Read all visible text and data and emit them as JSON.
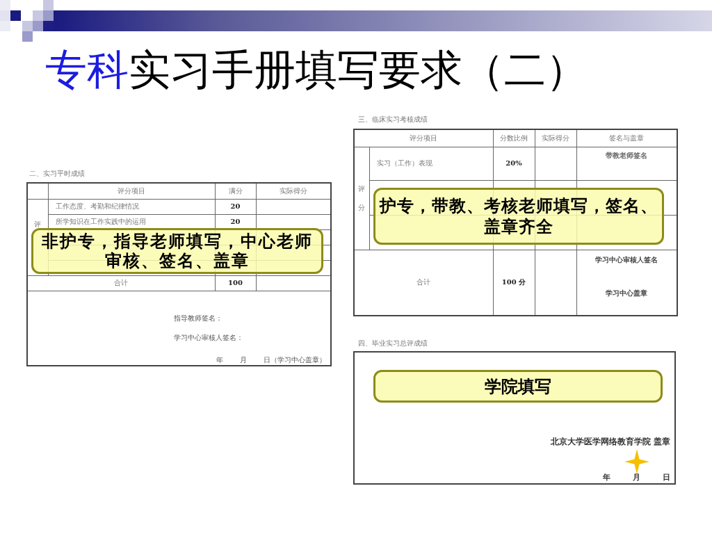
{
  "header": {
    "title_parts": [
      {
        "kind": "highlight",
        "text": "专科"
      },
      {
        "kind": "plain",
        "text": "实习手册填写要求（二）"
      }
    ]
  },
  "left_form": {
    "heading": "二、实习平时成绩",
    "columns": [
      "评分项目",
      "满分",
      "实际得分"
    ],
    "side_label": "评",
    "rows": [
      {
        "item": "工作态度、考勤和纪律情况",
        "full_score": "20"
      },
      {
        "item": "所学知识在工作实践中的运用",
        "full_score": "20"
      }
    ],
    "total": {
      "label": "合计",
      "full_score": "100"
    },
    "signatures": [
      "指导教师签名：",
      "学习中心审核人签名："
    ],
    "date_parts": [
      "年",
      "月",
      "日（学习中心盖章）"
    ],
    "callout": [
      "非护专，指导老师填写，中心老师",
      "审核、签名、盖章"
    ]
  },
  "clinical_form": {
    "heading": "三、临床实习考核成绩",
    "columns": [
      "评分项目",
      "分数比例",
      "实际得分",
      "签名与盖章"
    ],
    "side_label": "评分",
    "rows": [
      {
        "item": "实习（工作）表现",
        "ratio": "20%",
        "signatures": [
          "带教老师签名"
        ]
      }
    ],
    "total": {
      "label": "合计",
      "ratio": "100 分",
      "signatures": [
        "学习中心审核人签名",
        "学习中心盖章"
      ]
    },
    "callout": [
      "护专，带教、考核老师填写，签名、",
      "盖章齐全"
    ]
  },
  "final_form": {
    "heading": "四、毕业实习总评成绩",
    "callout": [
      "学院填写"
    ],
    "stamp": "北京大学医学网络教育学院 盖章",
    "date_parts": [
      "年",
      "月",
      "日"
    ]
  }
}
